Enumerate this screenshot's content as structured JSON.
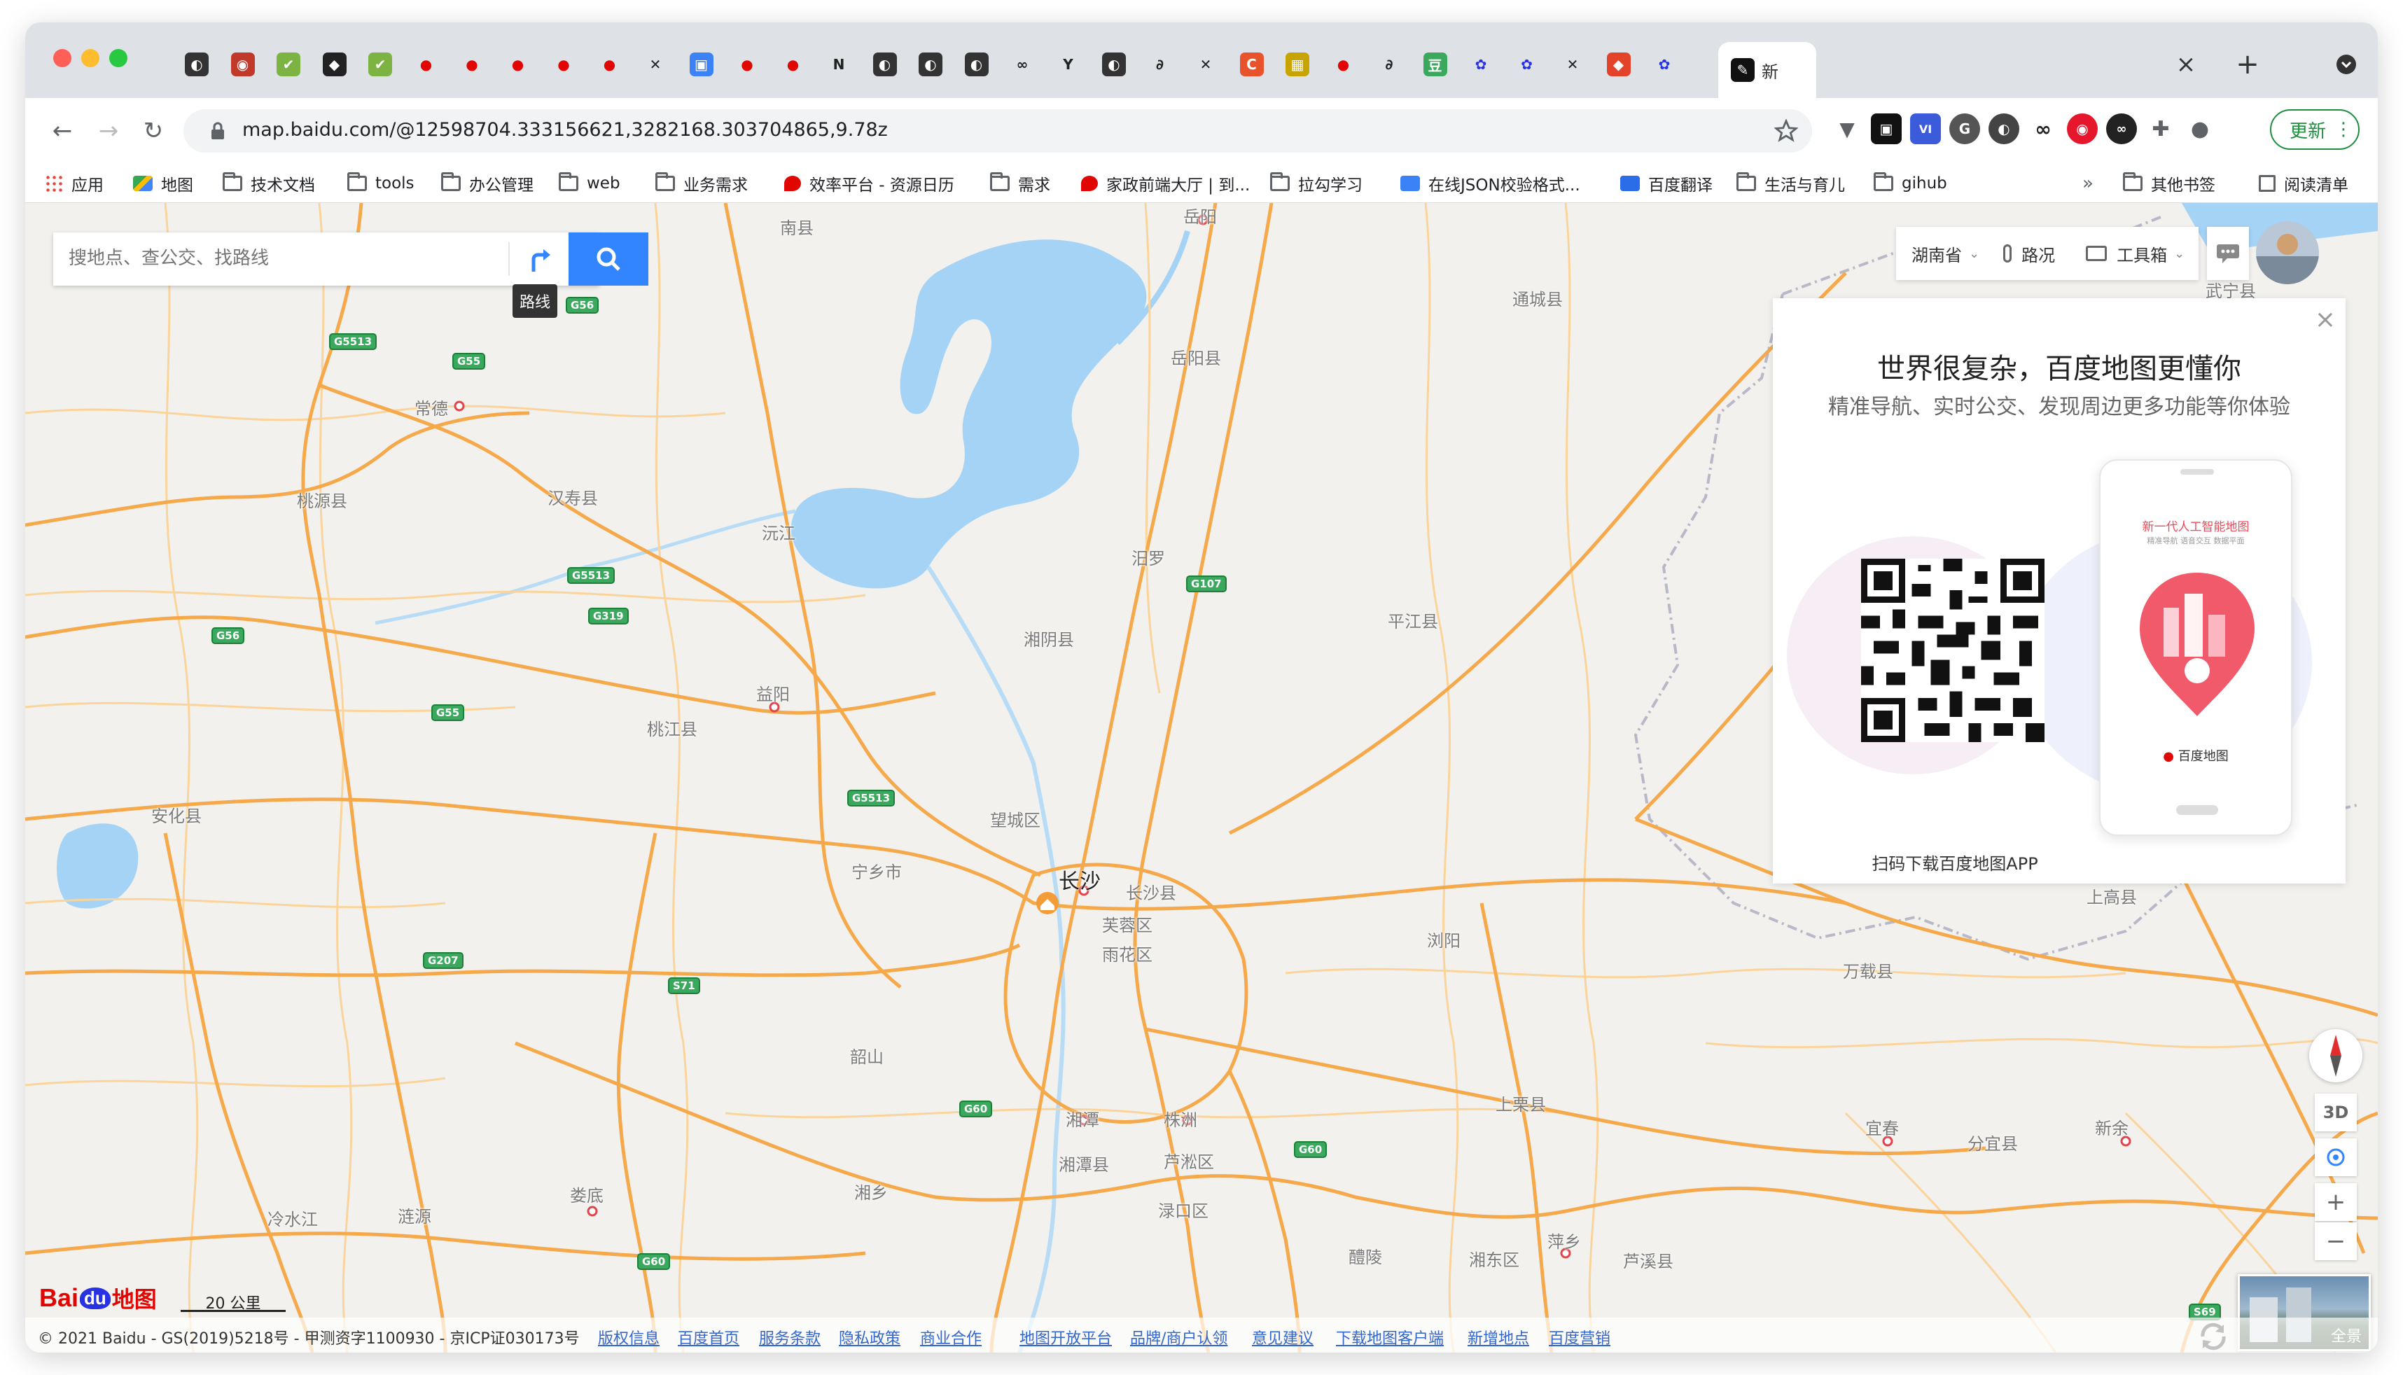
{
  "browser": {
    "url": "map.baidu.com/@12598704.333156621,3282168.303704865,9.78z",
    "update_label": "更新",
    "tab_short_label": "新",
    "new_tab_symbol": "+",
    "close_symbol": "×"
  },
  "bookmarks": [
    {
      "label": "应用",
      "icon": "apps-grid-icon"
    },
    {
      "label": "地图",
      "icon": "google-maps-icon"
    },
    {
      "label": "技术文档",
      "icon": "folder-icon"
    },
    {
      "label": "tools",
      "icon": "folder-icon"
    },
    {
      "label": "办公管理",
      "icon": "folder-icon"
    },
    {
      "label": "web",
      "icon": "folder-icon"
    },
    {
      "label": "业务需求",
      "icon": "folder-icon"
    },
    {
      "label": "效率平台 - 资源日历",
      "icon": "swan-icon"
    },
    {
      "label": "需求",
      "icon": "folder-icon"
    },
    {
      "label": "家政前端大厅 | 到...",
      "icon": "swan-icon"
    },
    {
      "label": "拉勾学习",
      "icon": "folder-icon"
    },
    {
      "label": "在线JSON校验格式...",
      "icon": "json-icon"
    },
    {
      "label": "百度翻译",
      "icon": "translate-icon"
    },
    {
      "label": "生活与育儿",
      "icon": "folder-icon"
    },
    {
      "label": "gihub",
      "icon": "folder-icon"
    }
  ],
  "bookmarks_overflow": "»",
  "bookmarks_right": [
    {
      "label": "其他书签",
      "icon": "folder-icon"
    },
    {
      "label": "阅读清单",
      "icon": "reading-list-icon"
    }
  ],
  "map": {
    "search_placeholder": "搜地点、查公交、找路线",
    "route_tooltip": "路线",
    "province_label": "湖南省",
    "traffic_label": "路况",
    "toolbox_label": "工具箱",
    "promo_title": "世界很复杂，百度地图更懂你",
    "promo_subtitle": "精准导航、实时公交、发现周边更多功能等你体验",
    "promo_qr_caption": "扫码下载百度地图APP",
    "phone_headline": "新一代人工智能地图",
    "phone_sub": "精准导航  语音交互  数据平面",
    "phone_brand": "百度地图",
    "compass_3d_label": "3D",
    "zoom_in_label": "+",
    "zoom_out_label": "−",
    "panorama_label": "全景",
    "scale_label": "20 公里",
    "logo_text_bai": "Bai",
    "logo_text_du": "du",
    "logo_text_map": "地图"
  },
  "places": {
    "changsha": "长沙",
    "nanxian": "南县",
    "yueyang": "岳阳",
    "yueyangxian": "岳阳县",
    "tongchengxian": "通城县",
    "wuning": "武宁县",
    "changde": "常德",
    "taoyuanxian": "桃源县",
    "hanshouxian": "汉寿县",
    "yuanjiang": "沅江",
    "miluo": "汨罗",
    "xiangyinxian": "湘阴县",
    "pingjiangxian": "平江县",
    "yiyang": "益阳",
    "taojiangxian": "桃江县",
    "anhuaxian": "安化县",
    "wangchengqu": "望城区",
    "ningxiangshi": "宁乡市",
    "changshaxian": "长沙县",
    "furongqu": "芙蓉区",
    "yuhuaqu": "雨花区",
    "liuyang": "浏阳",
    "wanzaixian": "万载县",
    "shanggaoxian": "上高县",
    "shaoshan": "韶山",
    "xiangtan": "湘潭",
    "zhuzhou": "株洲",
    "xiangtanxian": "湘潭县",
    "lukouqu": "渌口区",
    "lusongqu": "芦淞区",
    "shanglixian": "上栗县",
    "yichun": "宜春",
    "fenyixian": "分宜县",
    "xinyu": "新余",
    "xiangxiang": "湘乡",
    "loudi": "娄底",
    "lianyuan": "涟源",
    "lengshuijiang": "冷水江",
    "liling": "醴陵",
    "xiangdongqu": "湘东区",
    "pingxiang": "萍乡",
    "luxixian": "芦溪县"
  },
  "highways": {
    "g5513a": "G5513",
    "g55a": "G55",
    "g56a": "G56",
    "g5513b": "G5513",
    "g319": "G319",
    "g56b": "G56",
    "g107": "G107",
    "g55b": "G55",
    "g5513c": "G5513",
    "g207": "G207",
    "s71": "S71",
    "g60a": "G60",
    "g60b": "G60",
    "g60c": "G60",
    "s69": "S69"
  },
  "footer": {
    "copyright": "© 2021 Baidu - GS(2019)5218号 - 甲测资字1100930 - 京ICP证030173号",
    "links": [
      "版权信息",
      "百度首页",
      "服务条款",
      "隐私政策",
      "商业合作",
      "地图开放平台",
      "品牌/商户认领",
      "意见建议",
      "下载地图客户端",
      "新增地点",
      "百度营销"
    ]
  },
  "colors": {
    "road_major": "#f5a94a",
    "road_minor": "#fbd49c",
    "water": "#a5d3f6",
    "land": "#f2f1ee",
    "baidu_blue": "#3385ff",
    "baidu_red": "#e10602"
  }
}
